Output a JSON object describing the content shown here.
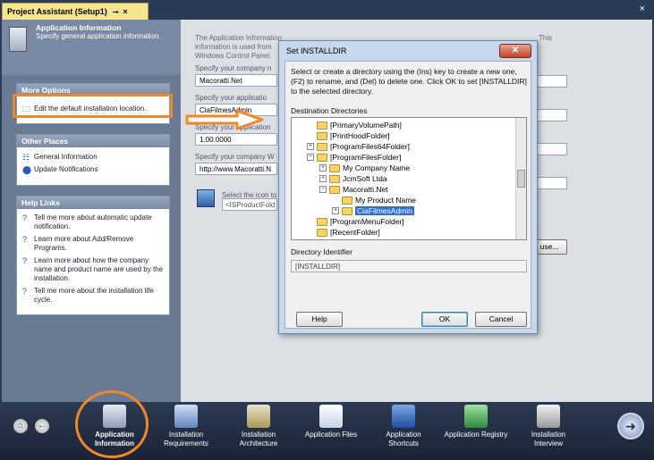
{
  "window": {
    "tab_title": "Project Assistant (Setup1)",
    "pin_icon": "pin-icon",
    "close_icon": "close-icon",
    "outer_close": "×"
  },
  "header": {
    "title": "Application Information",
    "subtitle": "Specify general application information."
  },
  "more_options": {
    "title": "More Options",
    "items": [
      "Edit the default installation location."
    ]
  },
  "other_places": {
    "title": "Other Places",
    "items": [
      "General Information",
      "Update Notifications"
    ]
  },
  "help_links": {
    "title": "Help Links",
    "items": [
      "Tell me more about automatic update notification.",
      "Learn more about Add/Remove Programs.",
      "Learn more about how the company name and product name are used by the installation.",
      "Tell me more about the installation life cycle."
    ]
  },
  "content": {
    "intro_line1": "The Application Information",
    "intro_line2": "information is used from",
    "intro_line3": "Windows Control Panel.",
    "intro_right": "This",
    "company_label": "Specify your company n",
    "company_value": "Macoratti.Net",
    "appname_label": "Specify your applicatio",
    "appname_value": "CiaFilmesAdmin",
    "version_label": "Specify your application",
    "version_value": "1.00.0000",
    "website_label": "Specify your company W",
    "website_value": "http://www.Macoratti.N",
    "icon_label": "Select the icon to",
    "icon_value": "<ISProductFold",
    "browse_label": "use..."
  },
  "dialog": {
    "title": "Set INSTALLDIR",
    "close_label": "✕",
    "instructions": "Select or create a directory using the (Ins) key to create a new one, (F2) to rename, and (Del) to delete one. Click OK to set [INSTALLDIR] to the selected directory.",
    "tree_label": "Destination Directories",
    "tree": [
      "[PrimaryVolumePath]",
      "[PrintHoodFolder]",
      "[ProgramFiles64Folder]",
      "[ProgramFilesFolder]",
      "My Company Name",
      "JcmSoft Ltda",
      "Macoratti.Net",
      "My Product Name",
      "CiaFilmesAdmin",
      "[ProgramMenuFolder]",
      "[RecentFolder]"
    ],
    "id_label": "Directory Identifier",
    "id_value": "[INSTALLDIR]",
    "help_button": "Help",
    "ok_button": "OK",
    "cancel_button": "Cancel"
  },
  "bottom_nav": {
    "items": [
      "Application Information",
      "Installation Requirements",
      "Installation Architecture",
      "Application Files",
      "Application Shortcuts",
      "Application Registry",
      "Installation Interview"
    ],
    "home_icon": "home-icon",
    "back_icon": "back-icon",
    "next_icon": "next-icon"
  },
  "colors": {
    "accent_orange": "#f0882a",
    "header_blue": "#2b3a55",
    "selection": "#2f6fd6"
  }
}
